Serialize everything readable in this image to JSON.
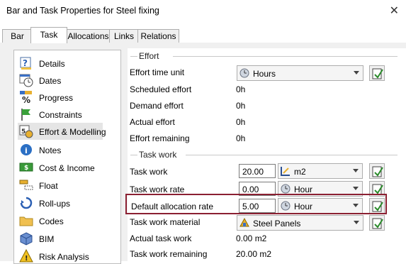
{
  "window": {
    "title": "Bar and Task Properties for Steel fixing",
    "close_glyph": "✕"
  },
  "tabs": [
    {
      "label": "Bar"
    },
    {
      "label": "Task",
      "active": true
    },
    {
      "label": "Allocations"
    },
    {
      "label": "Links"
    },
    {
      "label": "Relations"
    }
  ],
  "sidebar": {
    "items": [
      {
        "label": "Details",
        "icon": "details-icon"
      },
      {
        "label": "Dates",
        "icon": "calendar-clock-icon"
      },
      {
        "label": "Progress",
        "icon": "percent-icon"
      },
      {
        "label": "Constraints",
        "icon": "flag-icon"
      },
      {
        "label": "Effort & Modelling",
        "icon": "effort-modelling-icon",
        "selected": true
      },
      {
        "label": "Notes",
        "icon": "info-icon"
      },
      {
        "label": "Cost & Income",
        "icon": "money-icon"
      },
      {
        "label": "Float",
        "icon": "float-icon"
      },
      {
        "label": "Roll-ups",
        "icon": "rollup-icon"
      },
      {
        "label": "Codes",
        "icon": "folder-icon"
      },
      {
        "label": "BIM",
        "icon": "cube-icon"
      },
      {
        "label": "Risk Analysis",
        "icon": "warning-icon"
      }
    ]
  },
  "effort": {
    "section_label": "Effort",
    "time_unit_label": "Effort time unit",
    "time_unit_value": "Hours",
    "scheduled_label": "Scheduled effort",
    "scheduled_value": "0h",
    "demand_label": "Demand effort",
    "demand_value": "0h",
    "actual_label": "Actual effort",
    "actual_value": "0h",
    "remaining_label": "Effort remaining",
    "remaining_value": "0h"
  },
  "task_work": {
    "section_label": "Task work",
    "work_label": "Task work",
    "work_value": "20.00",
    "work_unit": "m2",
    "rate_label": "Task work rate",
    "rate_value": "0.00",
    "rate_unit": "Hour",
    "default_rate_label": "Default allocation rate",
    "default_rate_value": "5.00",
    "default_rate_unit": "Hour",
    "material_label": "Task work material",
    "material_value": "Steel Panels",
    "actual_label": "Actual task work",
    "actual_value": "0.00 m2",
    "remaining_label": "Task work remaining",
    "remaining_value": "20.00 m2"
  },
  "colors": {
    "highlight": "#8b2032",
    "tab_border": "#adadad",
    "panel_bg": "#f0f0f0"
  }
}
